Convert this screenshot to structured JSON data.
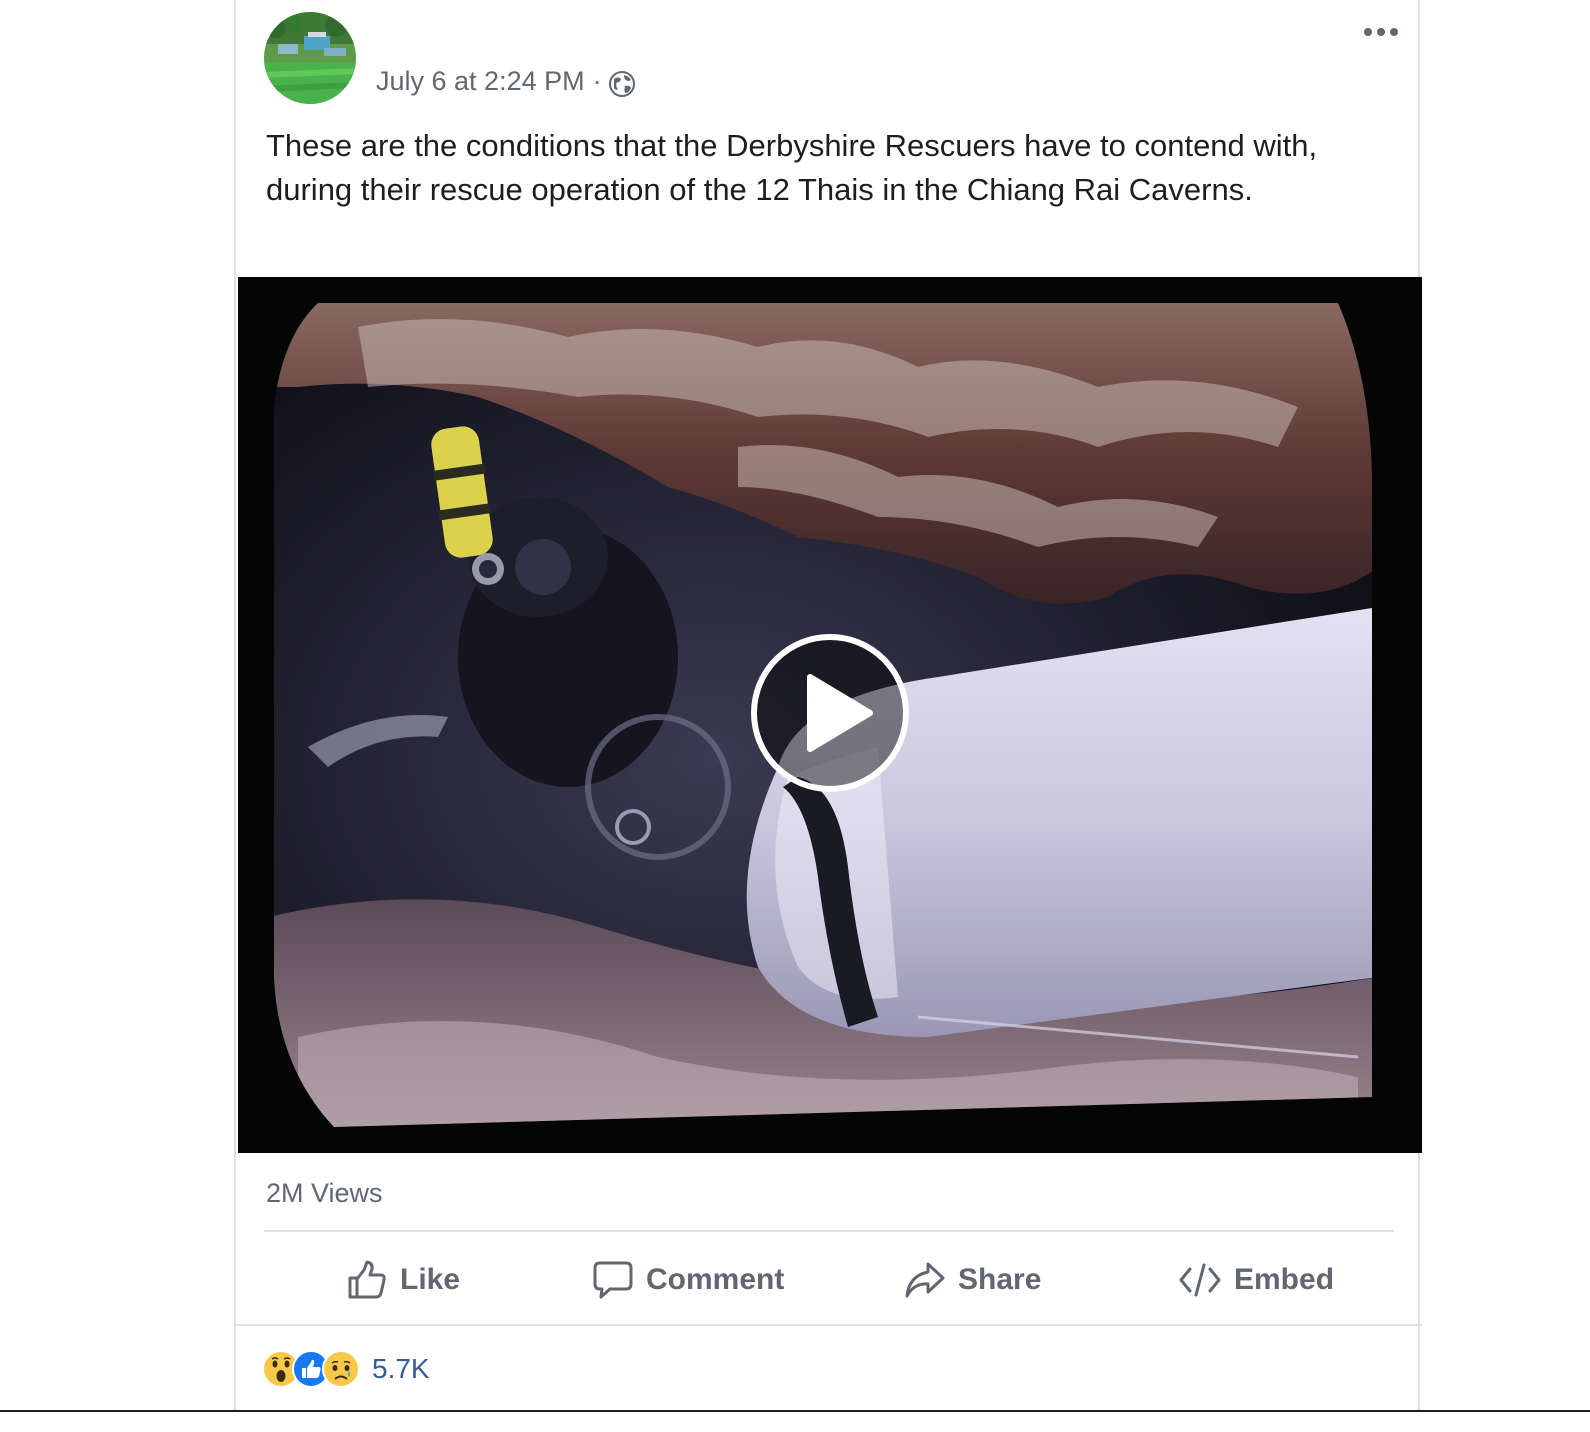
{
  "post": {
    "timestamp": "July 6 at 2:24 PM",
    "separator": "·",
    "privacy_icon": "globe-icon",
    "menu_icon": "more-options-icon",
    "text": "These are the conditions that the Derbyshire Rescuers have to contend with, during their rescue operation of the 12 Thais in the Chiang Rai Caverns."
  },
  "video": {
    "play_icon": "play-icon",
    "views": "2M Views"
  },
  "actions": {
    "like": "Like",
    "comment": "Comment",
    "share": "Share",
    "embed": "Embed"
  },
  "reactions": {
    "icons": [
      "wow-icon",
      "like-icon",
      "sad-icon"
    ],
    "count": "5.7K"
  },
  "colors": {
    "text_primary": "#1c1e21",
    "text_secondary": "#606770",
    "link_blue": "#385898",
    "like_blue": "#1877f2",
    "reaction_yellow": "#f7c94a",
    "divider": "#dddfe2"
  }
}
